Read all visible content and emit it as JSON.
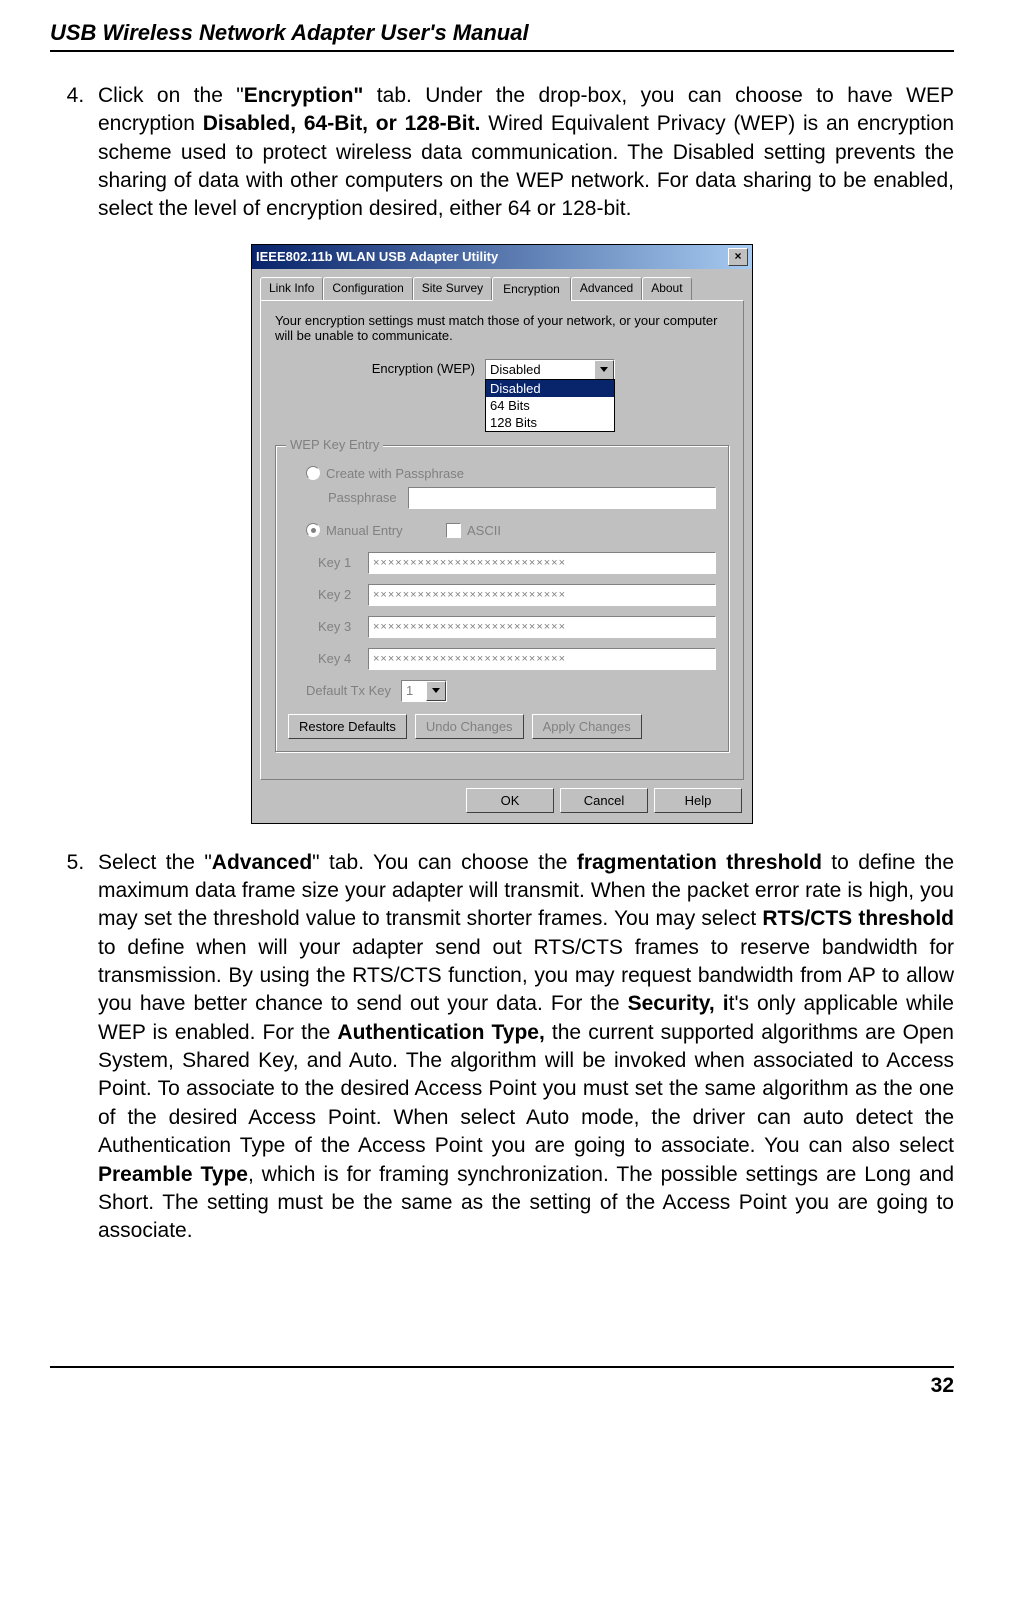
{
  "header": "USB Wireless Network Adapter User's Manual",
  "pageNumber": "32",
  "list": {
    "start": 4,
    "item4": {
      "pre": "Click on the \"",
      "b1": "Encryption\"",
      "mid1": " tab. Under the drop-box, you can choose to have WEP encryption ",
      "b2": "Disabled, 64-Bit, or 128-Bit.",
      "mid2": " Wired Equivalent Privacy (WEP) is an encryption scheme used to protect wireless data communication. The Disabled setting prevents the sharing of data with other computers on the WEP network. For data sharing to be enabled, select the level of encryption desired, either 64 or 128-bit."
    },
    "item5": {
      "pre": "Select the \"",
      "b1": "Advanced",
      "mid1": "\" tab. You can choose the ",
      "b2": "fragmentation threshold",
      "mid2": " to define the maximum data frame size your adapter will transmit. When the packet error rate is high, you may set the threshold value to transmit shorter frames. You may select ",
      "b3": "RTS/CTS threshold",
      "mid3": " to define when will your adapter send out RTS/CTS frames to reserve bandwidth for transmission. By using the RTS/CTS function, you may request bandwidth from AP to allow you have better chance to send out your data. For the ",
      "b4": "Security, i",
      "mid4": "t's only applicable while WEP is enabled. For the ",
      "b5": "Authentication Type,",
      "mid5": " the current supported algorithms are Open System, Shared Key, and Auto. The algorithm will be invoked when associated to Access Point. To associate to the desired Access Point you must set the same algorithm as the one of the desired Access Point. When select Auto mode, the driver can auto detect the Authentication Type of the Access Point you are going to associate. You can also select ",
      "b6": "Preamble Type",
      "mid6": ", which is for framing synchronization. The possible settings are Long and Short. The setting must be the same as the setting of the Access Point you are going to associate."
    }
  },
  "dialog": {
    "title": "IEEE802.11b WLAN USB Adapter Utility",
    "tabs": {
      "linkInfo": "Link Info",
      "configuration": "Configuration",
      "siteSurvey": "Site Survey",
      "encryption": "Encryption",
      "advanced": "Advanced",
      "about": "About"
    },
    "description": "Your encryption settings must match those of your network, or your computer will be unable to communicate.",
    "encLabel": "Encryption (WEP)",
    "encValue": "Disabled",
    "encOptions": {
      "opt1": "Disabled",
      "opt2": "64 Bits",
      "opt3": "128 Bits"
    },
    "groupTitle": "WEP Key Entry",
    "createPassphrase": "Create with Passphrase",
    "passphraseLabel": "Passphrase",
    "manualEntry": "Manual Entry",
    "ascii": "ASCII",
    "key1Label": "Key 1",
    "key2Label": "Key 2",
    "key3Label": "Key 3",
    "key4Label": "Key 4",
    "keyMask": "××××××××××××××××××××××××××",
    "defaultTxKey": "Default Tx Key",
    "defaultTxVal": "1",
    "restoreDefaults": "Restore Defaults",
    "undoChanges": "Undo Changes",
    "applyChanges": "Apply Changes",
    "ok": "OK",
    "cancel": "Cancel",
    "help": "Help"
  }
}
